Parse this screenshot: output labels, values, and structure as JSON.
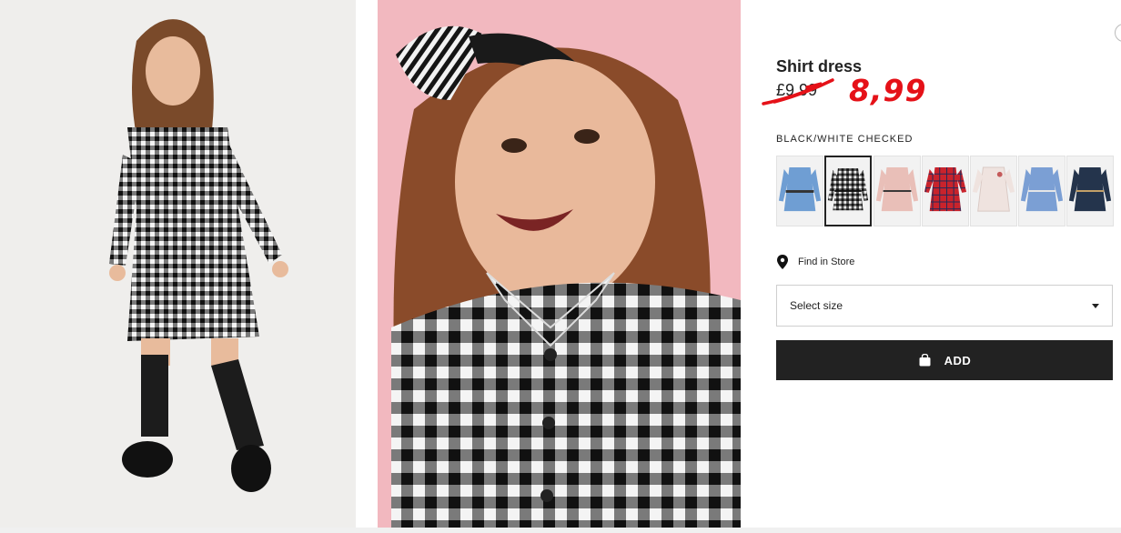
{
  "product": {
    "title": "Shirt dress",
    "old_price": "£9.99",
    "new_price": "8,99",
    "color_name": "BLACK/WHITE CHECKED"
  },
  "swatches": [
    {
      "color": "light-blue-denim",
      "hex": "#6f9ed3",
      "selected": false
    },
    {
      "color": "black-white-checked",
      "hex": "#2a2a2a",
      "selected": true
    },
    {
      "color": "light-pink",
      "hex": "#e9bfb8",
      "selected": false
    },
    {
      "color": "red-checked",
      "hex": "#c9232c",
      "selected": false
    },
    {
      "color": "white-patterned",
      "hex": "#efe3df",
      "selected": false
    },
    {
      "color": "blue",
      "hex": "#7b9fd4",
      "selected": false
    },
    {
      "color": "dark-blue",
      "hex": "#24344c",
      "selected": false
    }
  ],
  "store": {
    "find_label": "Find in Store",
    "icon": "map-pin-icon"
  },
  "size_select": {
    "label": "Select size",
    "icon": "chevron-down-icon"
  },
  "add_button": {
    "label": "ADD",
    "icon": "shopping-bag-icon"
  },
  "colors": {
    "accent_red": "#e51118",
    "button_bg": "#222222",
    "background_right_photo": "#f2b8bf",
    "background_left_photo": "#efeeec"
  }
}
